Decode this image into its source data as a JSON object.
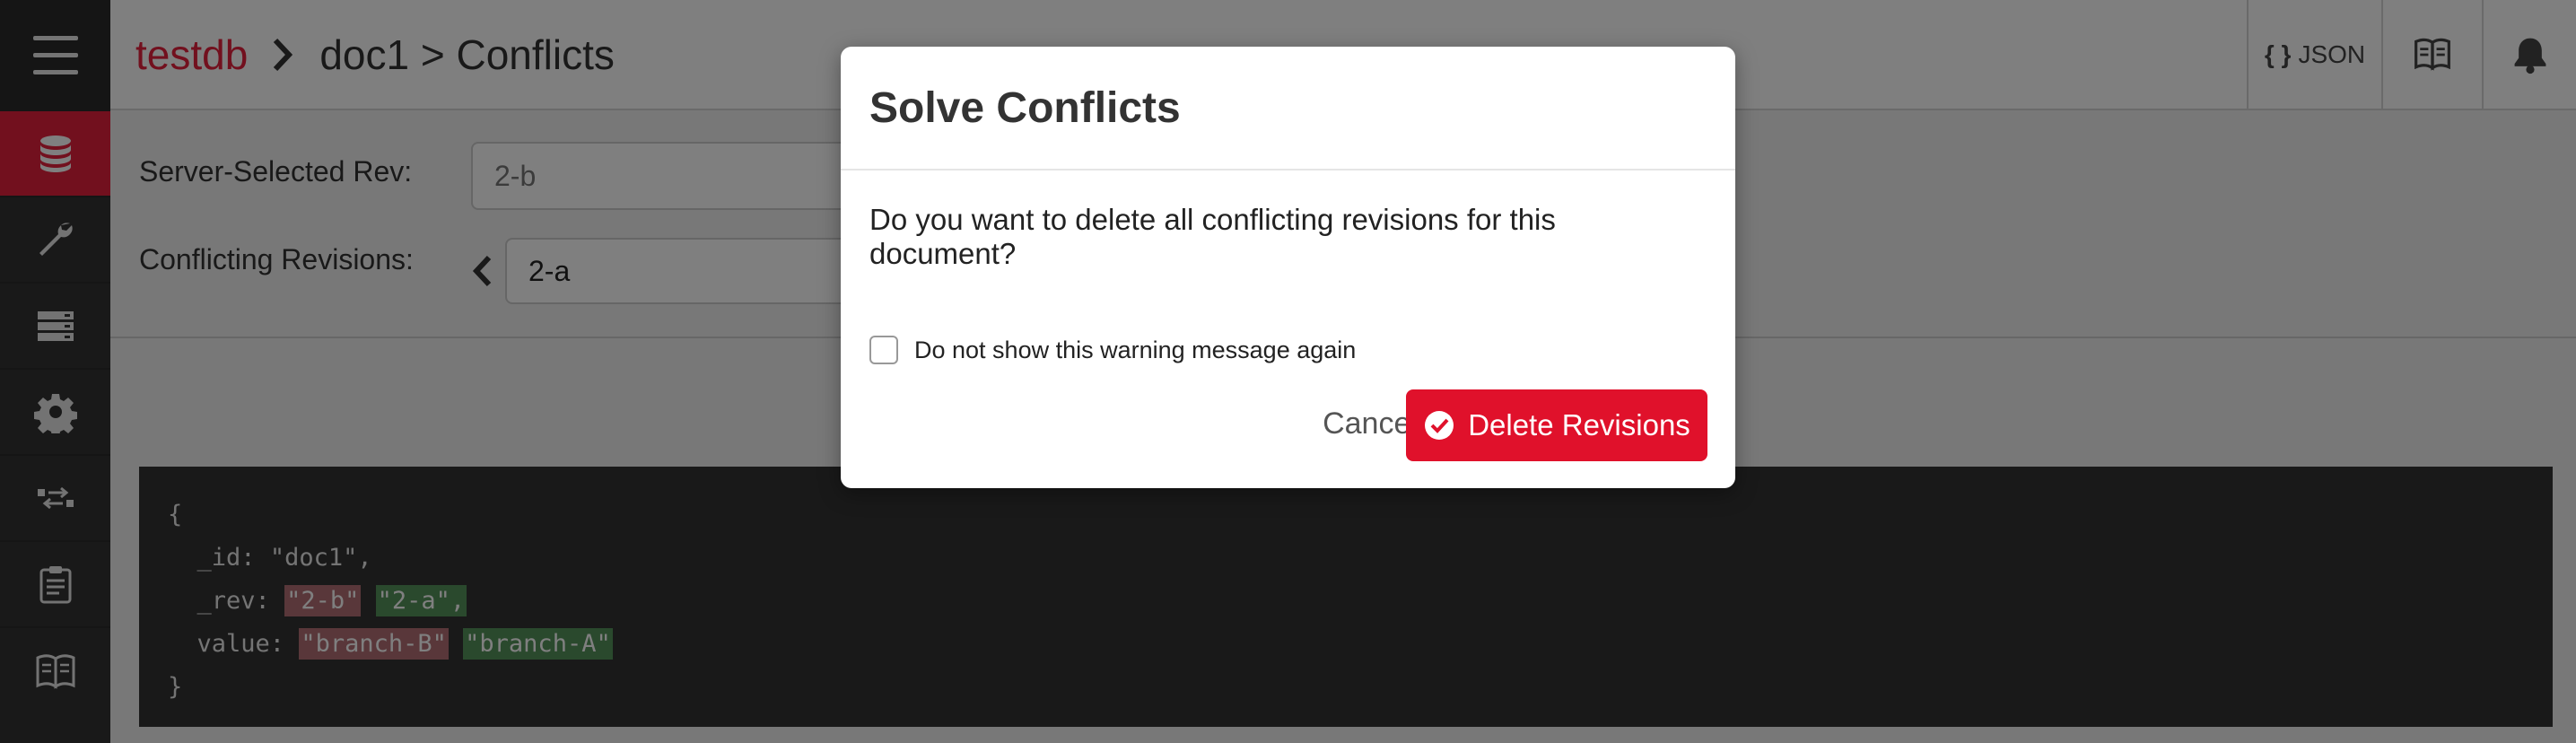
{
  "header": {
    "breadcrumb_db": "testdb",
    "breadcrumb_doc": "doc1 > Conflicts",
    "json_label": "JSON",
    "json_icon": "{ }"
  },
  "sidebar": {
    "items": [
      {
        "icon": "database-icon",
        "active": true
      },
      {
        "icon": "wrench-icon"
      },
      {
        "icon": "servers-icon"
      },
      {
        "icon": "gear-icon"
      },
      {
        "icon": "replication-icon"
      },
      {
        "icon": "clipboard-icon"
      },
      {
        "icon": "book-icon"
      }
    ]
  },
  "form": {
    "server_rev_label": "Server-Selected Rev:",
    "server_rev_value": "2-b",
    "conflicting_label": "Conflicting Revisions:",
    "conflicting_value": "2-a"
  },
  "code": {
    "open": "{",
    "id_key": "_id:",
    "id_val": "\"doc1\",",
    "rev_key": "_rev:",
    "rev_a": "\"2-b\"",
    "rev_b": "\"2-a\",",
    "value_key": "value:",
    "value_a": "\"branch-B\"",
    "value_b": "\"branch-A\"",
    "close": "}"
  },
  "modal": {
    "title": "Solve Conflicts",
    "message": "Do you want to delete all conflicting revisions for this document?",
    "checkbox_label": "Do not show this warning message again",
    "cancel_label": "Cancel",
    "delete_label": "Delete Revisions"
  },
  "colors": {
    "accent": "#e4213d",
    "sidebar": "#333333",
    "delete_button": "#e0112b",
    "diff_removed": "#b36f74",
    "diff_added": "#55925a"
  }
}
